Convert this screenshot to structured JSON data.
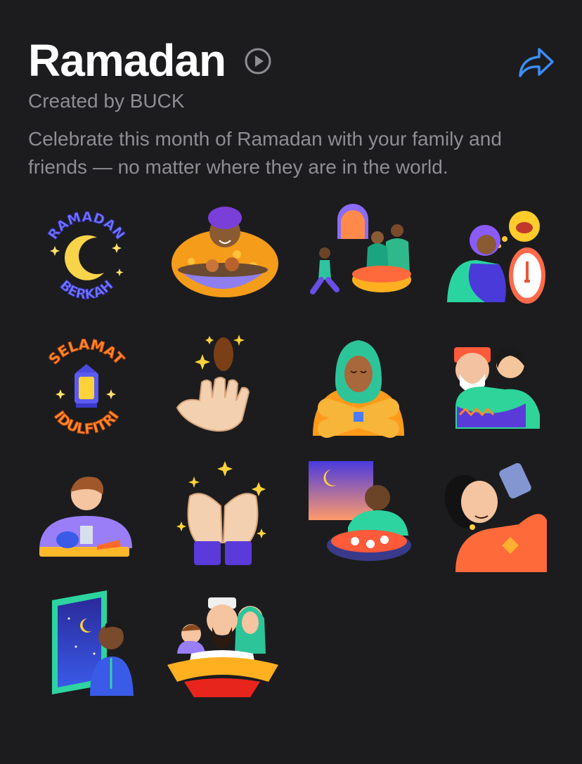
{
  "pack": {
    "title": "Ramadan",
    "creator": "Created by BUCK",
    "description": "Celebrate this month of Ramadan with your family and friends — no matter where they are in the world."
  },
  "icons": {
    "play": "play-circle-icon",
    "share": "share-arrow-icon"
  },
  "colors": {
    "background": "#1c1c1e",
    "title": "#ffffff",
    "secondary_text": "#8e8e93",
    "accent": "#3a8ef6"
  },
  "stickers": {
    "ramadan_berkah": {
      "top_text": "RAMADAN",
      "bottom_text": "BERKAH"
    },
    "selamat_idulfitri": {
      "top_text": "SELAMAT",
      "bottom_text": "IDULFITRI"
    }
  }
}
